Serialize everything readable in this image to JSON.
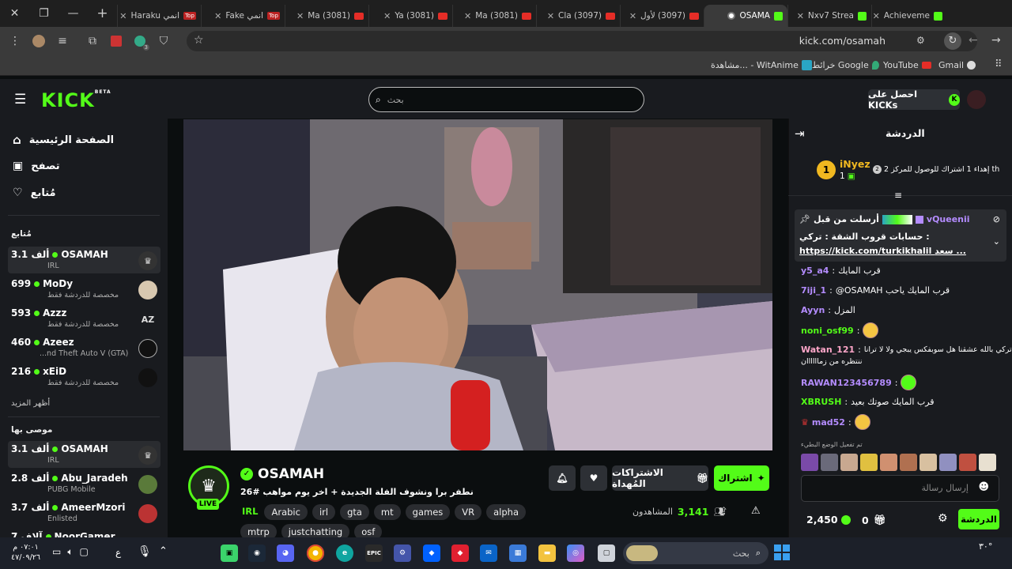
{
  "browser": {
    "tabs": [
      {
        "label": "انمي Haraku",
        "favicon": "top"
      },
      {
        "label": "انمي Fake",
        "favicon": "top"
      },
      {
        "label": "(3081) Ma",
        "favicon": "yt"
      },
      {
        "label": "(3081) Ya",
        "favicon": "yt"
      },
      {
        "label": "(3081) Ma",
        "favicon": "yt"
      },
      {
        "label": "(3097) Cla",
        "favicon": "yt"
      },
      {
        "label": "(3097) لأول",
        "favicon": "yt"
      },
      {
        "label": "OSAMA",
        "favicon": "kick"
      },
      {
        "label": "Nxv7 Strea",
        "favicon": "kick"
      },
      {
        "label": "Achieveme",
        "favicon": "kick"
      }
    ],
    "url": "kick.com/osamah",
    "extension_badge": "3",
    "bookmarks": [
      {
        "label": "Gmail"
      },
      {
        "label": "YouTube"
      },
      {
        "label": "خرائط Google"
      },
      {
        "label": "مشاهدة... - WitAnime"
      }
    ]
  },
  "header": {
    "logo": "KICK",
    "logo_badge": "BETA",
    "search_placeholder": "بحث",
    "get_kicks": "احصل على KICKs"
  },
  "sidebar": {
    "nav": [
      {
        "label": "الصفحة الرئيسية",
        "icon": "home-icon"
      },
      {
        "label": "تصفح",
        "icon": "browse-icon"
      },
      {
        "label": "مُتابع",
        "icon": "heart-icon"
      }
    ],
    "following_title": "مُتابع",
    "following": [
      {
        "name": "OSAMAH",
        "count": "3.1 ألف",
        "sub": "IRL",
        "selected": true
      },
      {
        "name": "MoDy",
        "count": "699",
        "sub": "مخصصة للدردشة فقط"
      },
      {
        "name": "Azzz",
        "count": "593",
        "sub": "مخصصة للدردشة فقط"
      },
      {
        "name": "Azeez",
        "count": "460",
        "sub": "...nd Theft Auto V (GTA)"
      },
      {
        "name": "xEiD",
        "count": "216",
        "sub": "مخصصة للدردشة فقط"
      }
    ],
    "show_more": "أظهر المزيد",
    "recommended_title": "موصى بها",
    "recommended": [
      {
        "name": "OSAMAH",
        "count": "3.1 ألف",
        "sub": "IRL",
        "selected": true
      },
      {
        "name": "Abu_Jaradeh",
        "count": "2.8 ألف",
        "sub": "PUBG Mobile"
      },
      {
        "name": "AmeerMzori",
        "count": "3.7 ألف",
        "sub": "Enlisted"
      },
      {
        "name": "NoorGamer",
        "count": "7 آلاف",
        "sub": ""
      }
    ]
  },
  "stream": {
    "channel": "OSAMAH",
    "live_label": "LIVE",
    "title": "نطفر برا ونشوف الفلة الجديدة + اخر يوم مواهب #26",
    "category": "IRL",
    "tags": [
      "Arabic",
      "irl",
      "gta",
      "mt",
      "games",
      "VR",
      "alpha"
    ],
    "tags2": [
      "mtrp",
      "justchatting",
      "osf"
    ],
    "subscribe": "اشتراك",
    "gift_subs": "الاشتراكات المُهداة",
    "viewers_label": "المشاهدون",
    "viewers": "3,141"
  },
  "chat": {
    "title": "الدردشة",
    "top_gifter": {
      "name": "iNyez",
      "rank": "1",
      "amount": "1",
      "text": "إهداء 1 اشتراك للوصول للمركز 2",
      "th": "th"
    },
    "pinned": {
      "by": "vQueenii",
      "label": "أرسلت من قبل",
      "line1": "حسابات قروب الشقة : تركي :",
      "line2": "https://kick.com/turkikhalil سعد ..."
    },
    "messages": [
      {
        "user": "y5_a4",
        "text": "قرب المايك",
        "color": "#b48cff"
      },
      {
        "user": "7iji_1",
        "text": "@OSAMAH قرب المايك ياحب",
        "color": "#b48cff"
      },
      {
        "user": "Ayyn",
        "text": "المزل",
        "color": "#b48cff"
      },
      {
        "user": "noni_osf99",
        "text": "",
        "color": "#53fc18",
        "emoji": "yellow"
      },
      {
        "user": "Watan_121",
        "text": "تركي بالله عشقنا هل سوبفكس يبجي ولا لا ترانا",
        "text2": "ننتظره من زماااااان",
        "color": "#ffa6c9"
      },
      {
        "user": "RAWAN123456789",
        "text": "",
        "color": "#b48cff",
        "emoji": "green"
      },
      {
        "user": "XBRUSH",
        "text": "قرب المايك صوتك بعيد",
        "color": "#53fc18"
      },
      {
        "user": "mad52",
        "text": "",
        "color": "#b48cff",
        "emoji": "yellow"
      }
    ],
    "hype_text": "تم تفعيل الوضع البطيء",
    "input_placeholder": "إرسال رسالة",
    "kicks_balance": "2,450",
    "gifts": "0",
    "chat_button": "الدردشة"
  },
  "taskbar": {
    "search_placeholder": "بحث",
    "time": "٠٧:٠١ م",
    "date": "٤٧/٠٩/٢٦",
    "lang": "ع",
    "temp": "٣٠°"
  }
}
